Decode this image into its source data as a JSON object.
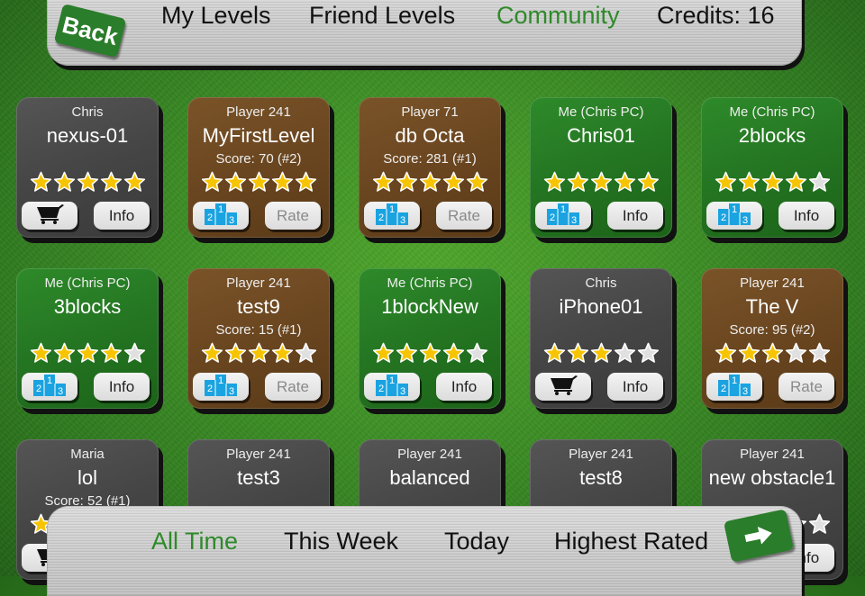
{
  "header": {
    "back_label": "Back",
    "tabs": [
      {
        "label": "My Levels",
        "active": false
      },
      {
        "label": "Friend Levels",
        "active": false
      },
      {
        "label": "Community",
        "active": true
      }
    ],
    "credits_label": "Credits: 16"
  },
  "footer": {
    "filters": [
      {
        "label": "All Time",
        "active": true
      },
      {
        "label": "This Week",
        "active": false
      },
      {
        "label": "Today",
        "active": false
      },
      {
        "label": "Highest Rated",
        "active": false
      }
    ],
    "next_icon": "arrow-right-icon"
  },
  "colors": {
    "accent_green": "#2e8a2a",
    "button_green": "#2a7d2a",
    "star_filled": "#f6c400",
    "star_empty": "#e0e0e0",
    "podium_blue": "#1aa3e0"
  },
  "levels": [
    {
      "owner": "Chris",
      "title": "nexus-01",
      "score": "",
      "stars": 5,
      "theme": "gray",
      "left_button": "cart-icon",
      "right_button": "Info",
      "right_disabled": false
    },
    {
      "owner": "Player 241",
      "title": "MyFirstLevel",
      "score": "Score: 70 (#2)",
      "stars": 5,
      "theme": "brown",
      "left_button": "podium-icon",
      "right_button": "Rate",
      "right_disabled": true
    },
    {
      "owner": "Player 71",
      "title": "db Octa",
      "score": "Score: 281 (#1)",
      "stars": 5,
      "theme": "brown",
      "left_button": "podium-icon",
      "right_button": "Rate",
      "right_disabled": true
    },
    {
      "owner": "Me (Chris PC)",
      "title": "Chris01",
      "score": "",
      "stars": 5,
      "theme": "green",
      "left_button": "podium-icon",
      "right_button": "Info",
      "right_disabled": false
    },
    {
      "owner": "Me (Chris PC)",
      "title": "2blocks",
      "score": "",
      "stars": 4,
      "theme": "green",
      "left_button": "podium-icon",
      "right_button": "Info",
      "right_disabled": false
    },
    {
      "owner": "Me (Chris PC)",
      "title": "3blocks",
      "score": "",
      "stars": 4,
      "theme": "green",
      "left_button": "podium-icon",
      "right_button": "Info",
      "right_disabled": false
    },
    {
      "owner": "Player 241",
      "title": "test9",
      "score": "Score: 15 (#1)",
      "stars": 4,
      "theme": "brown",
      "left_button": "podium-icon",
      "right_button": "Rate",
      "right_disabled": true
    },
    {
      "owner": "Me (Chris PC)",
      "title": "1blockNew",
      "score": "",
      "stars": 4,
      "theme": "green",
      "left_button": "podium-icon",
      "right_button": "Info",
      "right_disabled": false
    },
    {
      "owner": "Chris",
      "title": "iPhone01",
      "score": "",
      "stars": 3,
      "theme": "gray",
      "left_button": "cart-icon",
      "right_button": "Info",
      "right_disabled": false
    },
    {
      "owner": "Player 241",
      "title": "The V",
      "score": "Score: 95 (#2)",
      "stars": 3,
      "theme": "brown",
      "left_button": "podium-icon",
      "right_button": "Rate",
      "right_disabled": true
    },
    {
      "owner": "Maria",
      "title": "lol",
      "score": "Score: 52 (#1)",
      "stars": 1,
      "theme": "gray",
      "left_button": "cart-icon",
      "right_button": "",
      "right_disabled": false
    },
    {
      "owner": "Player 241",
      "title": "test3",
      "score": "",
      "stars": 0,
      "theme": "gray",
      "left_button": "",
      "right_button": "",
      "right_disabled": false
    },
    {
      "owner": "Player 241",
      "title": "balanced",
      "score": "",
      "stars": 0,
      "theme": "gray",
      "left_button": "",
      "right_button": "",
      "right_disabled": false
    },
    {
      "owner": "Player 241",
      "title": "test8",
      "score": "",
      "stars": 0,
      "theme": "gray",
      "left_button": "",
      "right_button": "",
      "right_disabled": false
    },
    {
      "owner": "Player 241",
      "title": "new obstacle1",
      "score": "",
      "stars": 0,
      "theme": "gray",
      "left_button": "",
      "right_button": "Info",
      "right_disabled": false
    }
  ]
}
